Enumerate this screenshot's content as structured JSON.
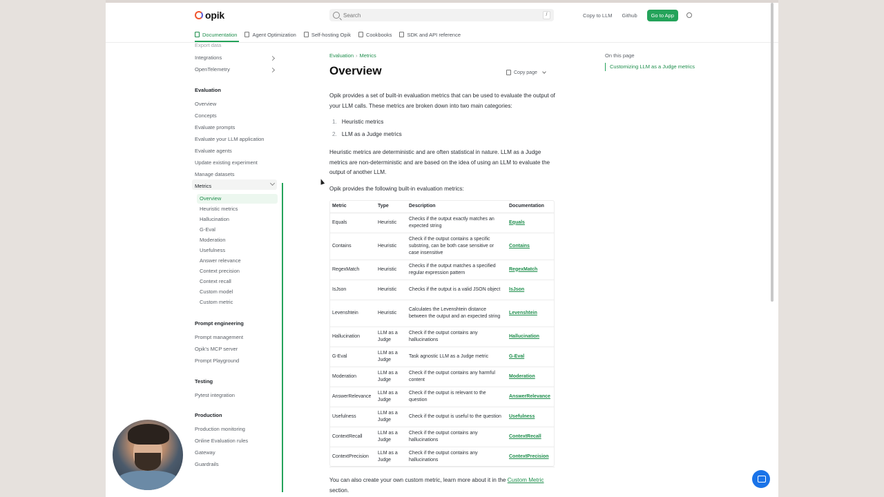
{
  "brand": {
    "name": "opik"
  },
  "search": {
    "placeholder": "Search",
    "shortcut": "/"
  },
  "top_links": {
    "copy_llm": "Copy to LLM",
    "github": "Github",
    "go_app": "Go to App"
  },
  "tabs": [
    "Documentation",
    "Agent Optimization",
    "Self-hosting Opik",
    "Cookbooks",
    "SDK and API reference"
  ],
  "sidebar": {
    "top_items": [
      "Export data",
      "Integrations",
      "OpenTelemetry"
    ],
    "evaluation": {
      "heading": "Evaluation",
      "items": [
        "Overview",
        "Concepts",
        "Evaluate prompts",
        "Evaluate your LLM application",
        "Evaluate agents",
        "Update existing experiment",
        "Manage datasets",
        "Metrics"
      ]
    },
    "metrics_sub": [
      "Overview",
      "Heuristic metrics",
      "Hallucination",
      "G-Eval",
      "Moderation",
      "Usefulness",
      "Answer relevance",
      "Context precision",
      "Context recall",
      "Custom model",
      "Custom metric"
    ],
    "prompt": {
      "heading": "Prompt engineering",
      "items": [
        "Prompt management",
        "Opik's MCP server",
        "Prompt Playground"
      ]
    },
    "testing": {
      "heading": "Testing",
      "items": [
        "Pytest integration"
      ]
    },
    "production": {
      "heading": "Production",
      "items": [
        "Production monitoring",
        "Online Evaluation rules",
        "Gateway",
        "Guardrails"
      ]
    }
  },
  "breadcrumb": {
    "parent": "Evaluation",
    "current": "Metrics"
  },
  "page": {
    "title": "Overview",
    "copy_page": "Copy page",
    "intro": "Opik provides a set of built-in evaluation metrics that can be used to evaluate the output of your LLM calls. These metrics are broken down into two main categories:",
    "list": [
      "Heuristic metrics",
      "LLM as a Judge metrics"
    ],
    "para2": "Heuristic metrics are deterministic and are often statistical in nature. LLM as a Judge metrics are non-deterministic and are based on the idea of using an LLM to evaluate the output of another LLM.",
    "para3": "Opik provides the following built-in evaluation metrics:",
    "table_headers": [
      "Metric",
      "Type",
      "Description",
      "Documentation"
    ],
    "rows": [
      [
        "Equals",
        "Heuristic",
        "Checks if the output exactly matches an expected string",
        "Equals"
      ],
      [
        "Contains",
        "Heuristic",
        "Check if the output contains a specific substring, can be both case sensitive or case insensitive",
        "Contains"
      ],
      [
        "RegexMatch",
        "Heuristic",
        "Checks if the output matches a specified regular expression pattern",
        "RegexMatch"
      ],
      [
        "IsJson",
        "Heuristic",
        "Checks if the output is a valid JSON object",
        "IsJson"
      ],
      [
        "Levenshtein",
        "Heuristic",
        "Calculates the Levenshtein distance between the output and an expected string",
        "Levenshtein"
      ],
      [
        "Hallucination",
        "LLM as a Judge",
        "Check if the output contains any hallucinations",
        "Hallucination"
      ],
      [
        "G-Eval",
        "LLM as a Judge",
        "Task agnostic LLM as a Judge metric",
        "G-Eval"
      ],
      [
        "Moderation",
        "LLM as a Judge",
        "Check if the output contains any harmful content",
        "Moderation"
      ],
      [
        "AnswerRelevance",
        "LLM as a Judge",
        "Check if the output is relevant to the question",
        "AnswerRelevance"
      ],
      [
        "Usefulness",
        "LLM as a Judge",
        "Check if the output is useful to the question",
        "Usefulness"
      ],
      [
        "ContextRecall",
        "LLM as a Judge",
        "Check if the output contains any hallucinations",
        "ContextRecall"
      ],
      [
        "ContextPrecision",
        "LLM as a Judge",
        "Check if the output contains any hallucinations",
        "ContextPrecision"
      ]
    ],
    "footer_text": "You can also create your own custom metric, learn more about it in the",
    "footer_link": "Custom Metric",
    "footer_end": "section."
  },
  "toc": {
    "title": "On this page",
    "items": [
      "Customizing LLM as a Judge metrics"
    ]
  },
  "colors": {
    "accent": "#24a35a",
    "link": "#1e8e4c"
  }
}
